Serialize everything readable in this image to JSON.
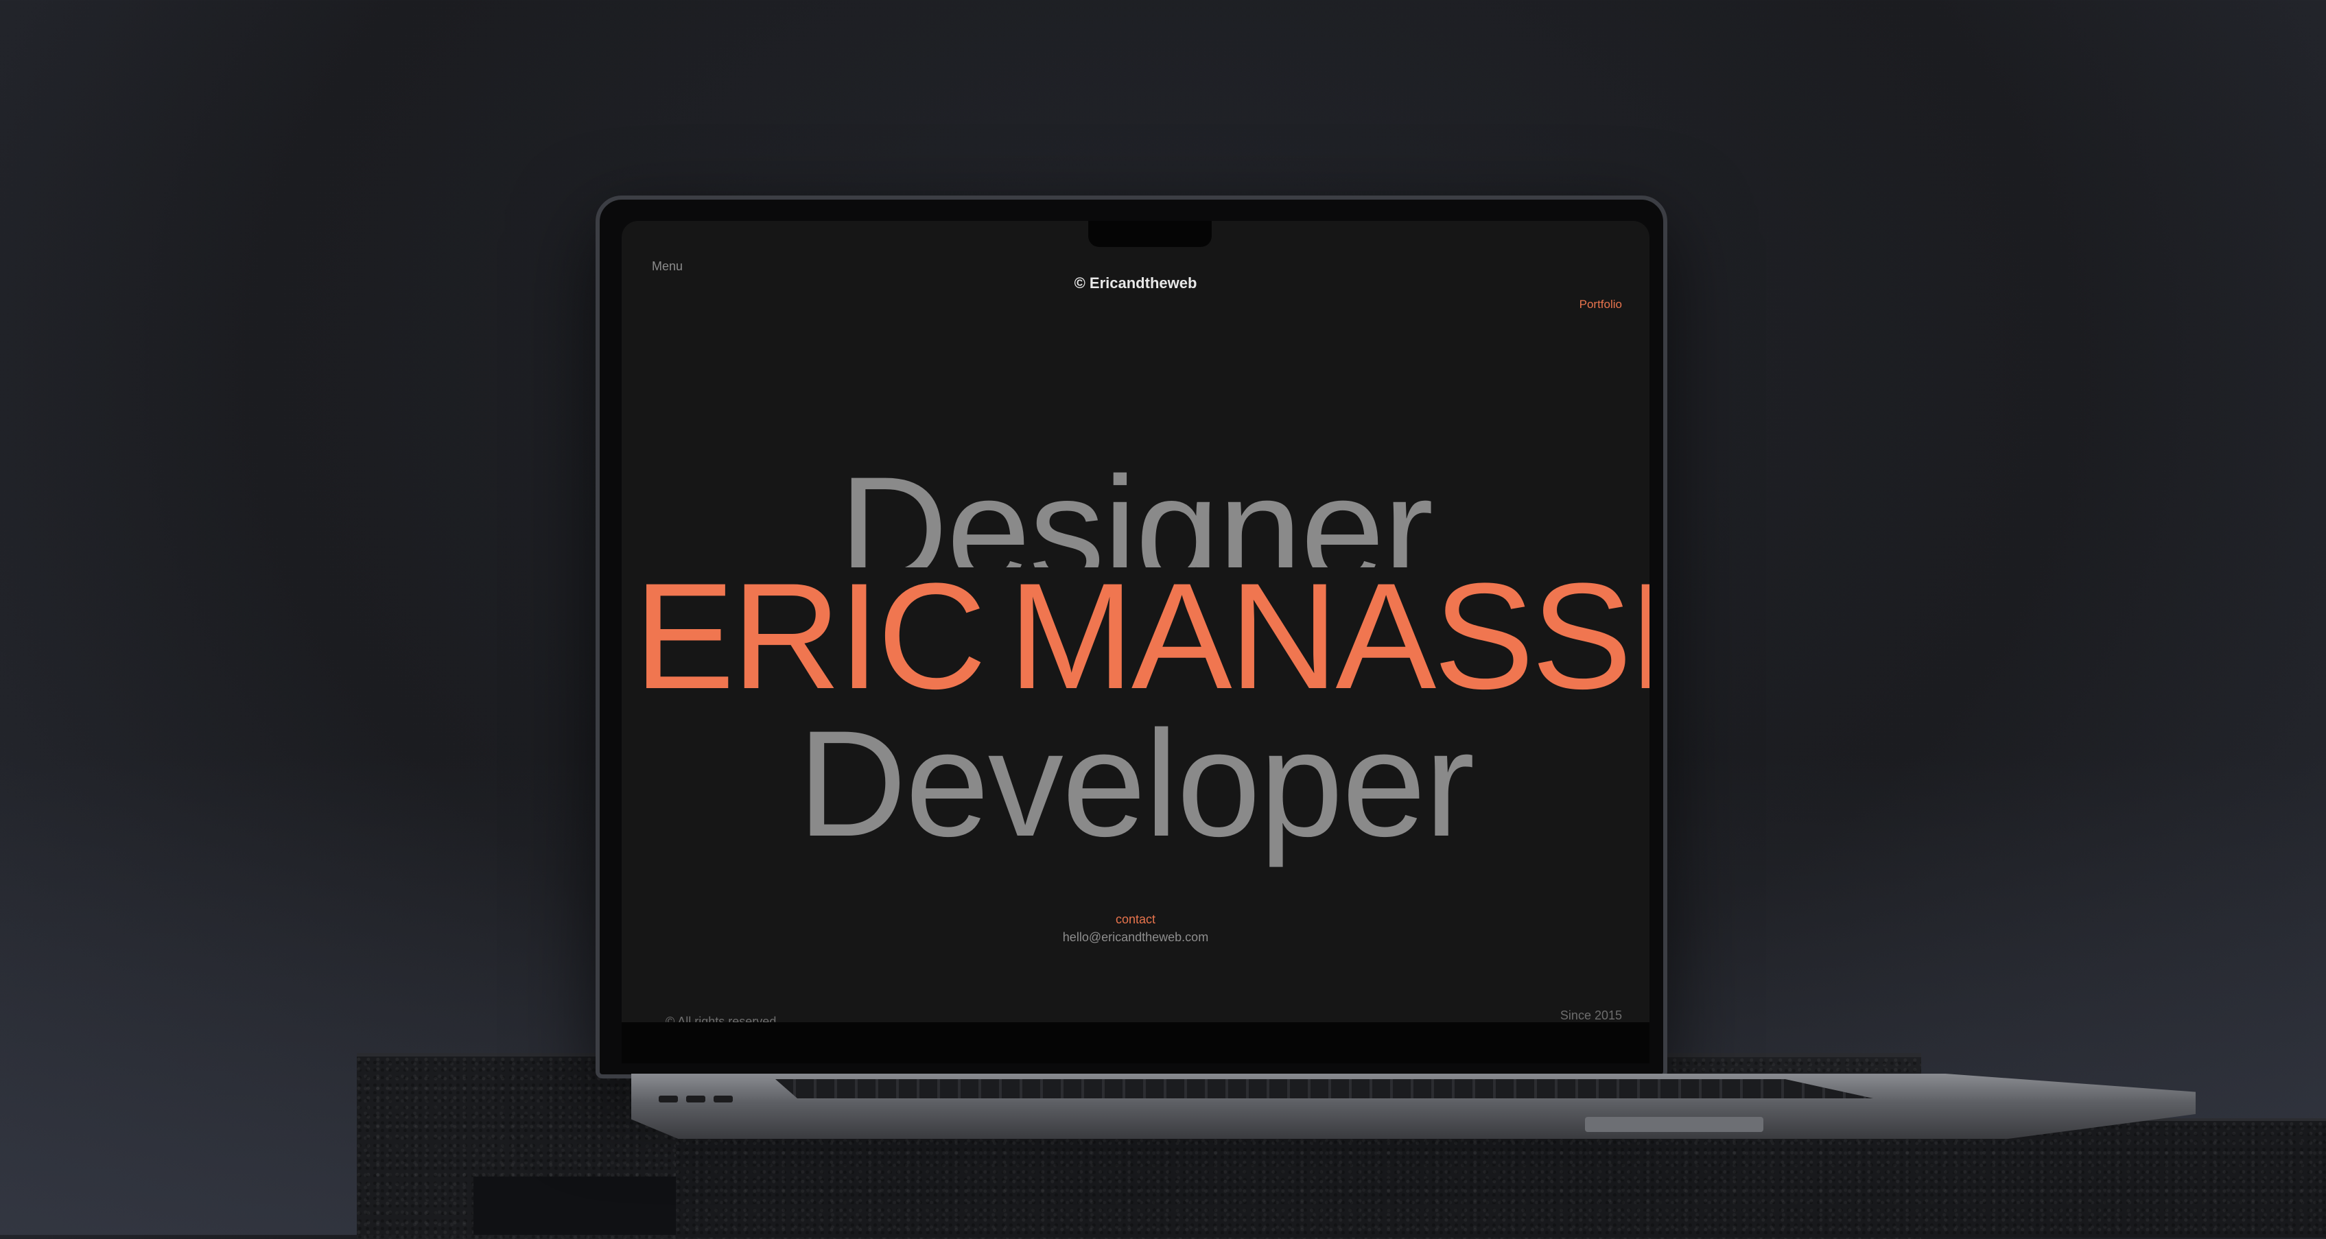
{
  "nav": {
    "menu_label": "Menu",
    "brand": "© Ericandtheweb",
    "portfolio_label": "Portfolio"
  },
  "hero": {
    "role_top": "Designer",
    "name_first": "ERIC",
    "name_last": "MANASSE",
    "role_bottom": "Developer"
  },
  "contact": {
    "label": "contact",
    "email": "hello@ericandtheweb.com"
  },
  "footer": {
    "rights": "© All rights reserved",
    "since": "Since 2015"
  },
  "colors": {
    "accent": "#f07650",
    "muted_text": "#8a8a8a",
    "screen_bg": "#161616"
  }
}
